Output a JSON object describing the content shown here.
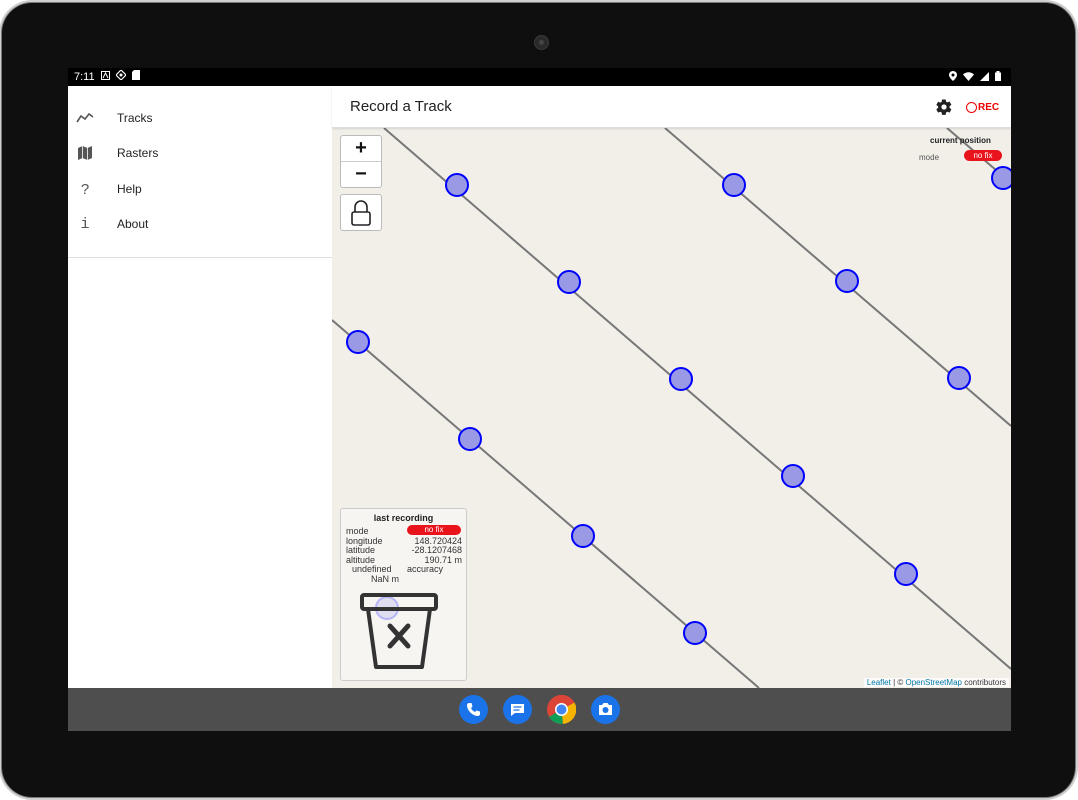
{
  "status_bar": {
    "time": "7:11",
    "left_icons": [
      "notification-a-icon",
      "location-target-icon",
      "sd-card-icon"
    ],
    "right_icons": [
      "location-pin-icon",
      "wifi-icon",
      "signal-icon",
      "battery-icon"
    ]
  },
  "drawer": {
    "items": [
      {
        "label": "Tracks",
        "icon": "tracks-icon"
      },
      {
        "label": "Rasters",
        "icon": "map-icon"
      },
      {
        "label": "Help",
        "icon": "help-icon"
      },
      {
        "label": "About",
        "icon": "info-icon"
      }
    ]
  },
  "appbar": {
    "title": "Record a Track",
    "settings_icon": "gear-icon",
    "rec_label": "REC"
  },
  "map": {
    "zoom_in_label": "+",
    "zoom_out_label": "−",
    "lock_icon": "lock-icon",
    "current_position": {
      "title": "current position",
      "mode_label": "mode",
      "mode_value": "no fix"
    },
    "last_recording": {
      "title": "last recording",
      "mode_label": "mode",
      "mode_value": "no fix",
      "longitude_label": "longitude",
      "longitude_value": "148.720424",
      "latitude_label": "latitude",
      "latitude_value": "-28.1207468",
      "altitude_label": "altitude",
      "altitude_value": "190.71 m",
      "accuracy_prefix": "undefined",
      "accuracy_label": "accuracy",
      "accuracy_value": "NaN m",
      "trash_icon": "trash-delete-icon"
    },
    "attribution": {
      "leaflet": "Leaflet",
      "separator": " | © ",
      "osm": "OpenStreetMap",
      "suffix": " contributors"
    },
    "colors": {
      "background": "#f2efe9",
      "track_line": "#777777",
      "marker_stroke": "#0000ff",
      "marker_fill": "#9999e6",
      "badge": "#e8131b"
    }
  },
  "dock": {
    "apps": [
      {
        "name": "Phone",
        "icon": "phone-icon"
      },
      {
        "name": "Messages",
        "icon": "messages-icon"
      },
      {
        "name": "Chrome",
        "icon": "chrome-icon"
      },
      {
        "name": "Camera",
        "icon": "camera-icon"
      }
    ]
  }
}
